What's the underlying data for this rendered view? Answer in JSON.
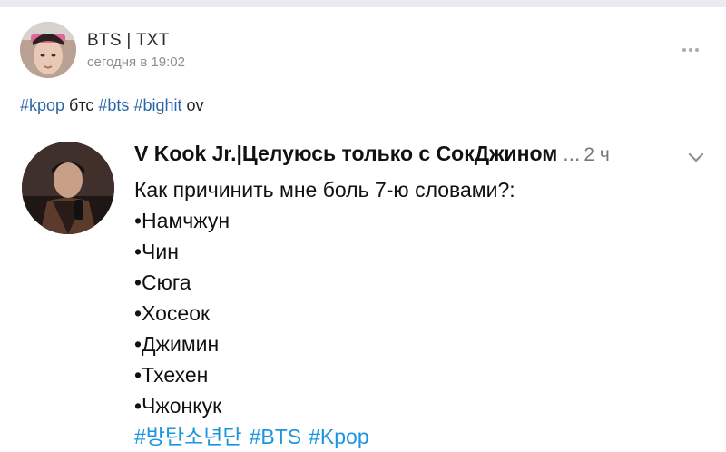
{
  "post": {
    "author": "BTS | TXT",
    "time": "сегодня в 19:02",
    "text_parts": [
      {
        "text": "#kpop",
        "tag": true
      },
      {
        "text": " бтс ",
        "tag": false
      },
      {
        "text": "#bts",
        "tag": true
      },
      {
        "text": " ",
        "tag": false
      },
      {
        "text": "#bighit",
        "tag": true
      },
      {
        "text": " ov",
        "tag": false
      }
    ]
  },
  "embedded": {
    "author": "V Kook Jr.|Целуюсь только с СокДжином",
    "ellipsis": "...",
    "time": "2 ч",
    "question": "Как причинить мне боль 7-ю словами?:",
    "items": [
      "•Намчжун",
      "•Чин",
      "•Сюга",
      "•Хосеок",
      "•Джимин",
      "•Тхехен",
      "•Чжонкук"
    ],
    "tags": [
      "#방탄소년단",
      "#BTS",
      "#Kpop"
    ]
  },
  "colors": {
    "link": "#2a65a8",
    "twitter_link": "#1b95e0",
    "muted": "#8a8f96"
  },
  "icons": {
    "more": "more-horizontal-icon",
    "chevron": "chevron-down-icon"
  }
}
